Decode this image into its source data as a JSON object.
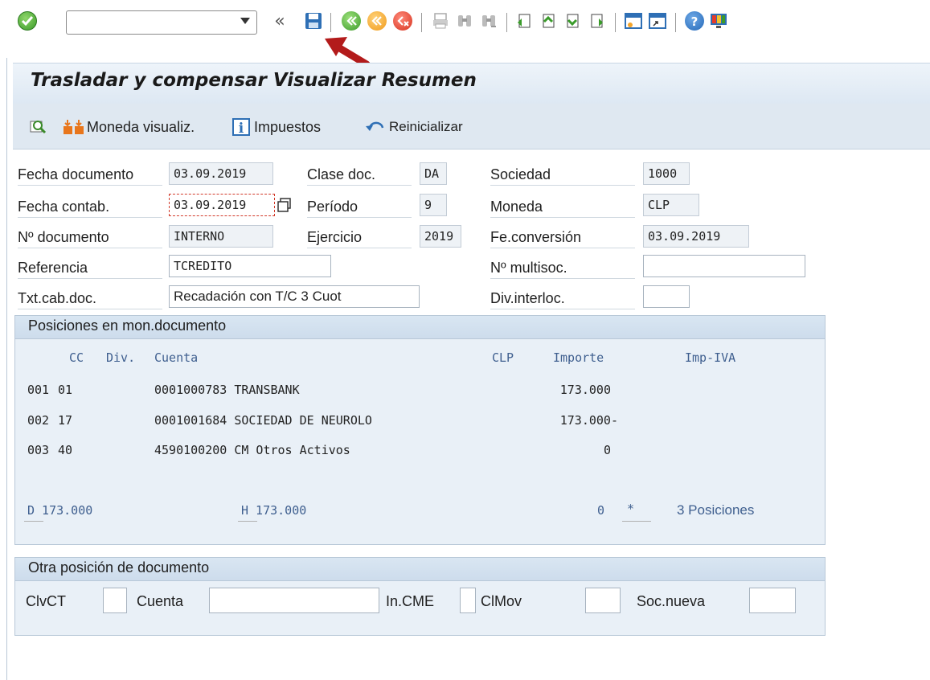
{
  "toolbar": {
    "command_field_value": "",
    "icons": [
      "ok-icon",
      "command-dropdown-icon",
      "prev-screens-icon",
      "save-icon",
      "back-icon",
      "exit-icon",
      "cancel-icon",
      "print-icon",
      "find-icon",
      "find-next-icon",
      "first-page-icon",
      "prev-page-icon",
      "next-page-icon",
      "last-page-icon",
      "create-session-icon",
      "shortcut-icon",
      "help-icon",
      "customize-layout-icon"
    ],
    "collapse_glyph": "«"
  },
  "title": "Trasladar y compensar Visualizar Resumen",
  "app_toolbar": {
    "buttons": [
      {
        "label": "",
        "icon": "overview-icon"
      },
      {
        "label": "Moneda visualiz.",
        "icon": "currency-icon"
      },
      {
        "label": "Impuestos",
        "icon": "info-icon"
      },
      {
        "label": "Reinicializar",
        "icon": "reset-icon"
      }
    ]
  },
  "header": {
    "fecha_documento": {
      "label": "Fecha documento",
      "value": "03.09.2019"
    },
    "fecha_contab": {
      "label": "Fecha contab.",
      "value": "03.09.2019"
    },
    "no_documento": {
      "label": "Nº documento",
      "value": "INTERNO"
    },
    "referencia": {
      "label": "Referencia",
      "value": "TCREDITO"
    },
    "txt_cab_doc": {
      "label": "Txt.cab.doc.",
      "value": "Recadación con T/C 3 Cuot"
    },
    "clase_doc": {
      "label": "Clase doc.",
      "value": "DA"
    },
    "periodo": {
      "label": "Período",
      "value": "9"
    },
    "ejercicio": {
      "label": "Ejercicio",
      "value": "2019"
    },
    "sociedad": {
      "label": "Sociedad",
      "value": "1000"
    },
    "moneda": {
      "label": "Moneda",
      "value": "CLP"
    },
    "fe_conversion": {
      "label": "Fe.conversión",
      "value": "03.09.2019"
    },
    "no_multisoc": {
      "label": "Nº multisoc.",
      "value": ""
    },
    "div_interloc": {
      "label": "Div.interloc.",
      "value": ""
    }
  },
  "positions": {
    "title": "Posiciones en mon.documento",
    "columns": {
      "cc": "CC",
      "div": "Div.",
      "cuenta": "Cuenta",
      "currency": "CLP",
      "importe": "Importe",
      "imp_iva": "Imp-IVA"
    },
    "rows": [
      {
        "cc": "001",
        "div": "01",
        "cuenta": "0001000783 TRANSBANK",
        "importe": "173.000"
      },
      {
        "cc": "002",
        "div": "17",
        "cuenta": "0001001684 SOCIEDAD DE NEUROLO",
        "importe": "173.000-"
      },
      {
        "cc": "003",
        "div": "40",
        "cuenta": "4590100200 CM Otros Activos",
        "importe": "0"
      }
    ],
    "totals": {
      "debit": "D 173.000",
      "credit": "H 173.000",
      "balance": "0",
      "marker": "*",
      "count": "3 Posiciones"
    }
  },
  "other_position": {
    "title": "Otra posición de documento",
    "fields": {
      "clvct": {
        "label": "ClvCT",
        "value": ""
      },
      "cuenta": {
        "label": "Cuenta",
        "value": ""
      },
      "in_cme": {
        "label": "In.CME",
        "value": ""
      },
      "clmov": {
        "label": "ClMov",
        "value": ""
      },
      "soc_nueva": {
        "label": "Soc.nueva",
        "value": ""
      }
    }
  },
  "colors": {
    "accent": "#3f5f8f",
    "title_bg": "#e6eef7",
    "group_bg": "#e9f0f7",
    "annotation_arrow": "#b31b1b"
  }
}
